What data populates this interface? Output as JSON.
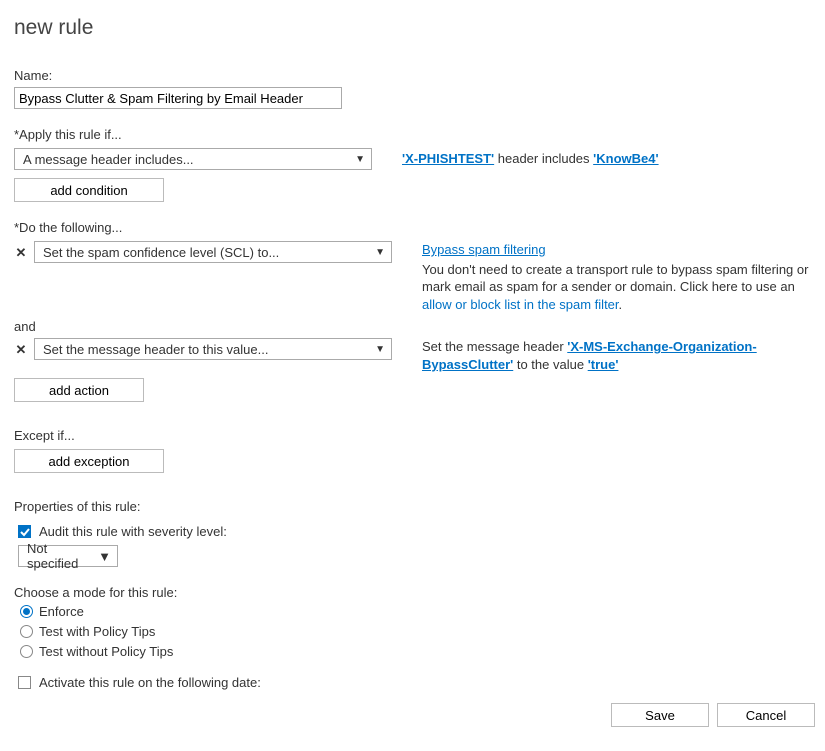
{
  "title": "new rule",
  "name_label": "Name:",
  "name_value": "Bypass Clutter & Spam Filtering by Email Header",
  "apply_label": "*Apply this rule if...",
  "condition_dd": "A message header includes...",
  "add_condition": "add condition",
  "cond_desc": {
    "header": "'X-PHISHTEST'",
    "mid": " header includes ",
    "value": "'KnowBe4'"
  },
  "do_label": "*Do the following...",
  "action1_dd": "Set the spam confidence level (SCL) to...",
  "action2_dd": "Set the message header to this value...",
  "and_label": "and",
  "add_action": "add action",
  "bypass_link": "Bypass spam filtering",
  "bypass_text": "You don't need to create a transport rule to bypass spam filtering or mark email as spam for a sender or domain. Click here to use an ",
  "bypass_link2": "allow or block list in the spam filter",
  "period": ".",
  "action2_desc": {
    "pre": "Set the message header ",
    "header": "'X-MS-Exchange-Organization-BypassClutter'",
    "mid": " to the value ",
    "value": "'true'"
  },
  "except_label": "Except if...",
  "add_exception": "add exception",
  "props_label": "Properties of this rule:",
  "audit_label": "Audit this rule with severity level:",
  "severity_value": "Not specified",
  "mode_label": "Choose a mode for this rule:",
  "mode_enforce": "Enforce",
  "mode_test_tips": "Test with Policy Tips",
  "mode_test_notips": "Test without Policy Tips",
  "activate_label": "Activate this rule on the following date:",
  "save": "Save",
  "cancel": "Cancel"
}
